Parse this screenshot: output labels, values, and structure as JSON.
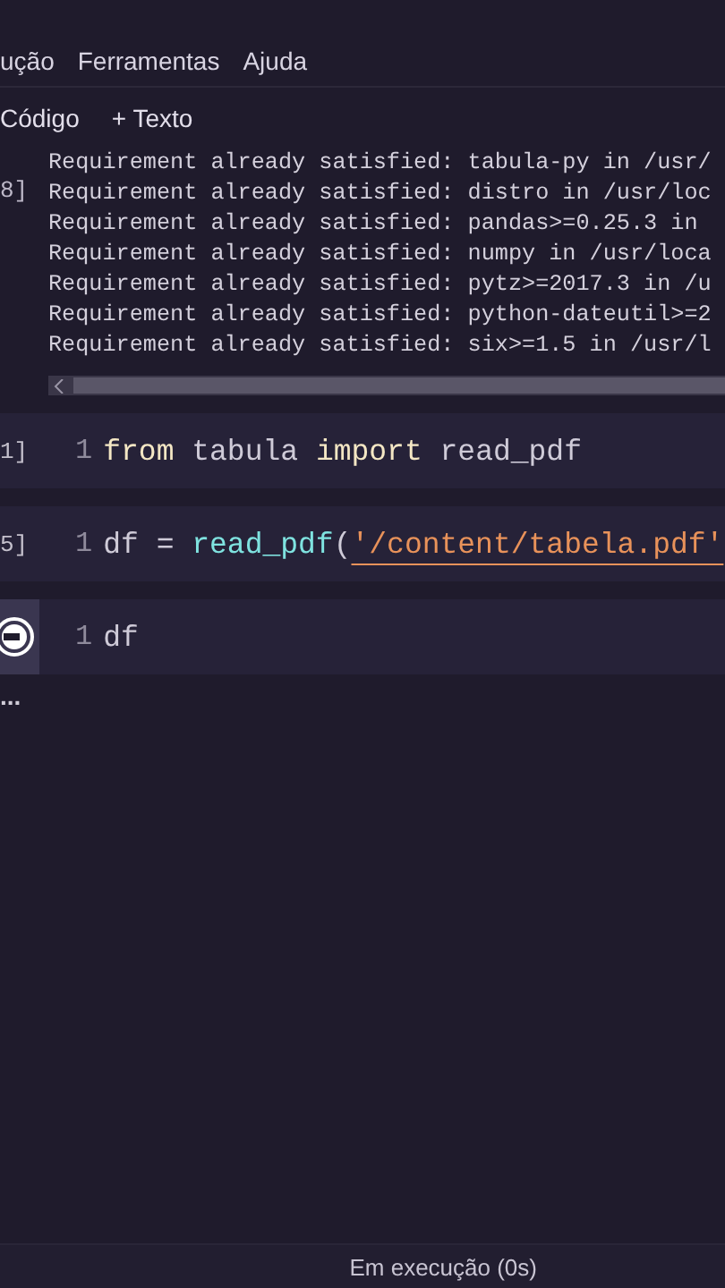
{
  "menu": [
    "ução",
    "Ferramentas",
    "Ajuda"
  ],
  "toolbar": [
    "Código",
    "+ Texto"
  ],
  "output": {
    "exec_label": "8]",
    "lines": [
      "Requirement already satisfied: tabula-py in /usr/",
      "Requirement already satisfied: distro in /usr/loc",
      "Requirement already satisfied: pandas>=0.25.3 in ",
      "Requirement already satisfied: numpy in /usr/loca",
      "Requirement already satisfied: pytz>=2017.3 in /u",
      "Requirement already satisfied: python-dateutil>=2",
      "Requirement already satisfied: six>=1.5 in /usr/l"
    ]
  },
  "cells": [
    {
      "exec_label": "1]",
      "running": false,
      "line_number": "1",
      "tokens": [
        {
          "text": "from",
          "kind": "keyword"
        },
        {
          "text": " tabula ",
          "kind": "plain"
        },
        {
          "text": "import",
          "kind": "keyword"
        },
        {
          "text": " read_pdf",
          "kind": "plain"
        }
      ]
    },
    {
      "exec_label": "5]",
      "running": false,
      "line_number": "1",
      "tokens": [
        {
          "text": "df = ",
          "kind": "plain"
        },
        {
          "text": "read_pdf",
          "kind": "function"
        },
        {
          "text": "(",
          "kind": "plain"
        },
        {
          "text": "'/content/tabela.pdf'",
          "kind": "string"
        }
      ]
    },
    {
      "running": true,
      "line_number": "1",
      "tokens": [
        {
          "text": "df",
          "kind": "plain"
        }
      ],
      "output_indicator": "..."
    }
  ],
  "status_bar": "Em execução (0s)"
}
